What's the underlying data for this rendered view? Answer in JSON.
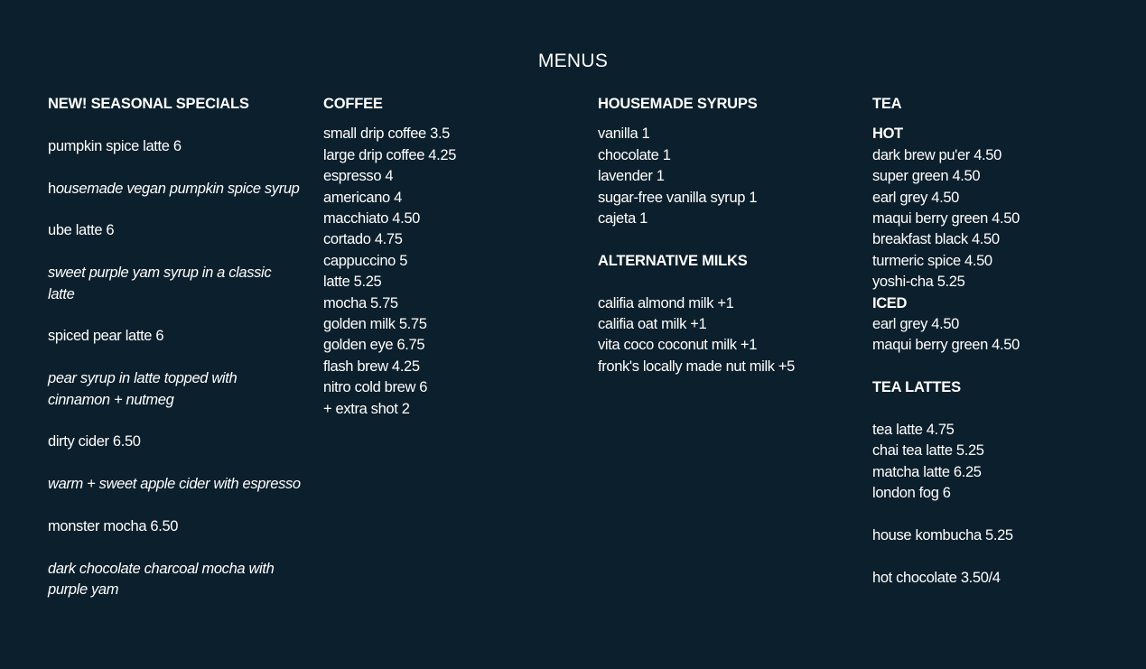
{
  "title": "MENUS",
  "seasonal": {
    "heading": "NEW! SEASONAL SPECIALS",
    "items": [
      {
        "name": "pumpkin spice latte 6",
        "desc_first": "h",
        "desc_rest": "ousemade vegan pumpkin spice syrup"
      },
      {
        "name": "ube latte 6",
        "desc_first": "",
        "desc_rest": "sweet purple yam syrup in a classic latte"
      },
      {
        "name": "spiced pear latte 6",
        "desc_first": "",
        "desc_rest": "pear syrup in latte topped with cinnamon + nutmeg"
      },
      {
        "name": "dirty cider 6.50",
        "desc_first": "",
        "desc_rest": "warm + sweet apple cider with espresso"
      },
      {
        "name": "monster mocha 6.50",
        "desc_first": "",
        "desc_rest": "dark chocolate charcoal mocha with purple yam"
      }
    ]
  },
  "coffee": {
    "heading": "COFFEE",
    "items": [
      "small drip coffee 3.5",
      "large drip coffee 4.25",
      "espresso 4",
      "americano 4",
      "macchiato 4.50",
      "cortado 4.75",
      "cappuccino 5",
      "latte 5.25",
      "mocha 5.75",
      "golden milk 5.75",
      "golden eye 6.75",
      "flash brew 4.25",
      "nitro cold brew 6",
      "+ extra shot 2"
    ]
  },
  "syrups": {
    "heading": "HOUSEMADE SYRUPS",
    "items": [
      "vanilla 1",
      "chocolate 1",
      "lavender 1",
      "sugar-free vanilla syrup 1",
      "cajeta 1"
    ]
  },
  "milks": {
    "heading": "ALTERNATIVE MILKS",
    "items": [
      "califia almond milk +1",
      "califia oat milk +1",
      "vita coco coconut milk +1",
      "fronk's locally made nut milk +5"
    ]
  },
  "tea": {
    "heading": "TEA",
    "hot_label": "HOT",
    "hot": [
      "dark brew pu'er 4.50",
      "super green 4.50",
      "earl grey 4.50",
      "maqui berry green 4.50",
      "breakfast black 4.50",
      "turmeric spice 4.50",
      "yoshi-cha 5.25"
    ],
    "iced_label": "ICED",
    "iced": [
      "earl grey 4.50",
      "maqui berry green 4.50"
    ]
  },
  "tea_lattes": {
    "heading": "TEA LATTES",
    "items": [
      "tea latte 4.75",
      "chai tea latte 5.25",
      "matcha latte 6.25",
      "london fog 6"
    ],
    "extra": [
      "house kombucha 5.25",
      "hot chocolate 3.50/4"
    ]
  }
}
